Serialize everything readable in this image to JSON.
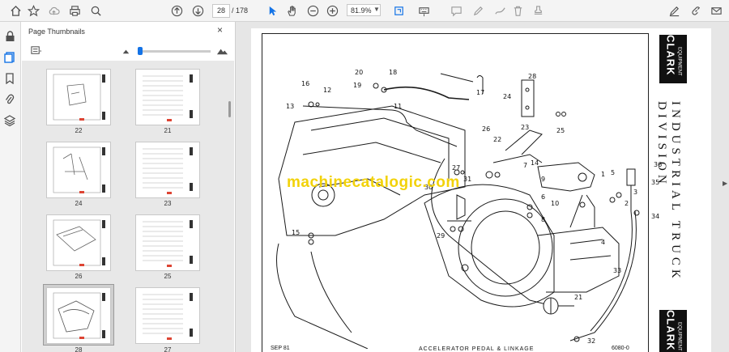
{
  "toolbar": {
    "page_current": "28",
    "page_total": "/ 178",
    "zoom": "81.9%"
  },
  "panel": {
    "title": "Page Thumbnails",
    "close": "×",
    "thumbs": [
      {
        "label": "22"
      },
      {
        "label": "21"
      },
      {
        "label": "24"
      },
      {
        "label": "23"
      },
      {
        "label": "26"
      },
      {
        "label": "25"
      },
      {
        "label": "28"
      },
      {
        "label": "27"
      }
    ]
  },
  "document": {
    "side_title": "INDUSTRIAL TRUCK DIVISION",
    "logo_top": "CLARK",
    "logo_sub": "EQUIPMENT",
    "watermark": "machinecatalogic.com",
    "footer_left": "SEP 81",
    "footer_mid": "ACCELERATOR PEDAL & LINKAGE",
    "footer_right": "6080-0",
    "callouts": [
      "16",
      "12",
      "13",
      "20",
      "19",
      "18",
      "11",
      "17",
      "28",
      "24",
      "23",
      "25",
      "22",
      "26",
      "27",
      "31",
      "30",
      "29",
      "15",
      "8",
      "9",
      "10",
      "7",
      "6",
      "3",
      "2",
      "5",
      "4",
      "36",
      "35",
      "34",
      "33",
      "32",
      "21",
      "14",
      "1"
    ]
  }
}
